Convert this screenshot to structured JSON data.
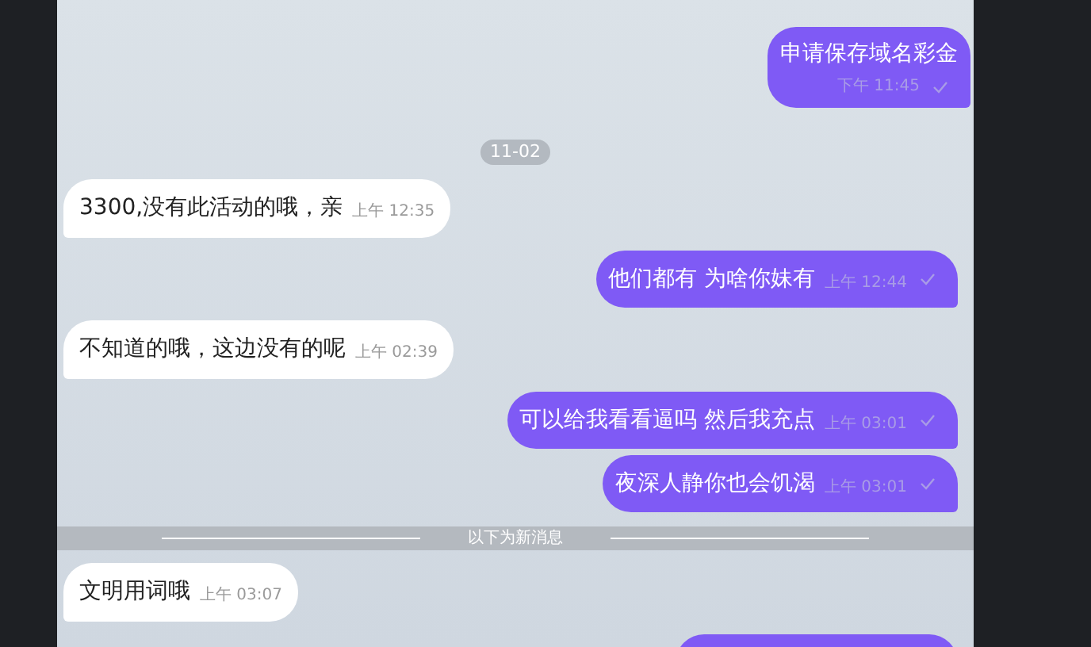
{
  "messages": [
    {
      "kind": "outgoing_stacked",
      "text": "申请保存域名彩金",
      "time": "下午 11:45"
    },
    {
      "kind": "date",
      "text": "11-02"
    },
    {
      "kind": "incoming",
      "text": "3300,没有此活动的哦，亲",
      "time": "上午 12:35"
    },
    {
      "kind": "outgoing",
      "text": "他们都有 为啥你妹有",
      "time": "上午 12:44"
    },
    {
      "kind": "incoming",
      "text": "不知道的哦，这边没有的呢",
      "time": "上午 02:39"
    },
    {
      "kind": "outgoing",
      "text": "可以给我看看逼吗 然后我充点",
      "time": "上午 03:01"
    },
    {
      "kind": "outgoing",
      "text": "夜深人静你也会饥渴",
      "time": "上午 03:01"
    },
    {
      "kind": "divider",
      "text": "以下为新消息"
    },
    {
      "kind": "incoming",
      "text": "文明用词哦",
      "time": "上午 03:07"
    },
    {
      "kind": "outgoing_partial"
    }
  ]
}
